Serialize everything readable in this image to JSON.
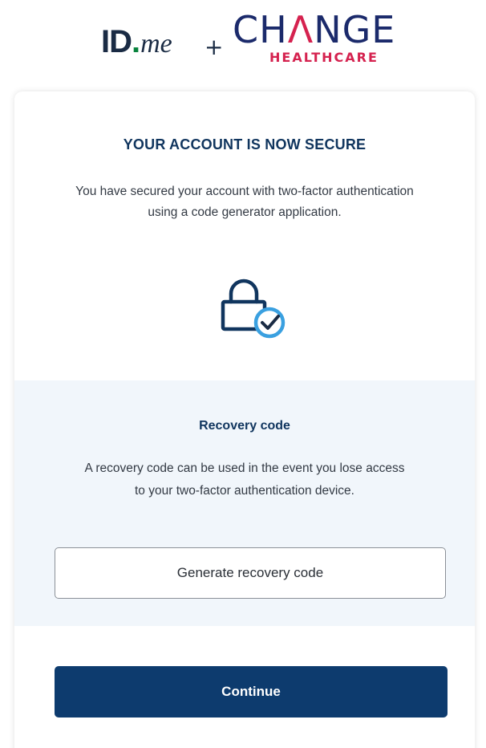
{
  "header": {
    "idme_logo": {
      "id": "ID",
      "dot": ".",
      "me": "me"
    },
    "plus": "+",
    "change_logo": {
      "ch": "CH",
      "a": "Λ",
      "nge": "NGE",
      "healthcare": "HEALTHCARE"
    }
  },
  "card": {
    "title": "YOUR ACCOUNT IS NOW SECURE",
    "description": "You have secured your account with two-factor authentication using a code generator application.",
    "icon": "lock-check-icon",
    "recovery": {
      "title": "Recovery code",
      "description": "A recovery code can be used in the event you lose access to your two-factor authentication device.",
      "button_label": "Generate recovery code"
    },
    "continue_label": "Continue"
  },
  "colors": {
    "primary": "#0d3b6e",
    "heading": "#10355e",
    "accent_red": "#d5224f",
    "panel_bg": "#f1f6fb",
    "check_blue": "#3aa0e0"
  }
}
